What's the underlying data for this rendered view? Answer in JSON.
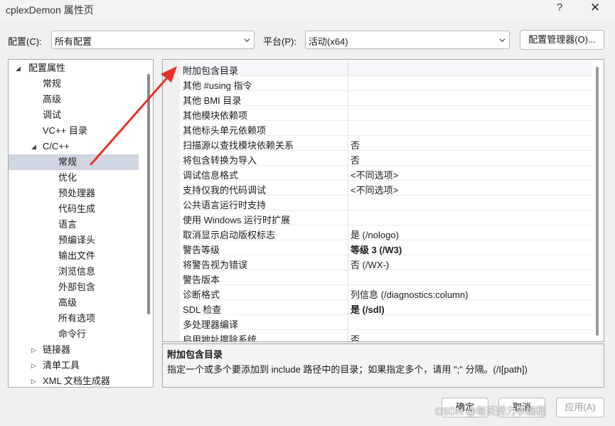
{
  "window": {
    "title": "cplexDemon 属性页",
    "help": "?",
    "close": "✕"
  },
  "toolbar": {
    "config_label": "配置(C):",
    "config_value": "所有配置",
    "platform_label": "平台(P):",
    "platform_value": "活动(x64)",
    "config_manager_button": "配置管理器(O)..."
  },
  "tree": {
    "root": "配置属性",
    "items": [
      "常规",
      "高级",
      "调试",
      "VC++ 目录"
    ],
    "cc": "C/C++",
    "cc_items": [
      "常规",
      "优化",
      "预处理器",
      "代码生成",
      "语言",
      "预编译头",
      "输出文件",
      "浏览信息",
      "外部包含",
      "高级",
      "所有选项",
      "命令行"
    ],
    "collapsed": [
      "链接器",
      "清单工具",
      "XML 文档生成器"
    ],
    "selected": "常规"
  },
  "properties": [
    {
      "name": "附加包含目录",
      "value": ""
    },
    {
      "name": "其他 #using 指令",
      "value": ""
    },
    {
      "name": "其他 BMI 目录",
      "value": ""
    },
    {
      "name": "其他模块依赖项",
      "value": ""
    },
    {
      "name": "其他标头单元依赖项",
      "value": ""
    },
    {
      "name": "扫描源以查找模块依赖关系",
      "value": "否"
    },
    {
      "name": "将包含转换为导入",
      "value": "否"
    },
    {
      "name": "调试信息格式",
      "value": "<不同选项>"
    },
    {
      "name": "支持仅我的代码调试",
      "value": "<不同选项>"
    },
    {
      "name": "公共语言运行时支持",
      "value": ""
    },
    {
      "name": "使用 Windows 运行时扩展",
      "value": ""
    },
    {
      "name": "取消显示启动版权标志",
      "value": "是 (/nologo)"
    },
    {
      "name": "警告等级",
      "value": "等级 3 (/W3)"
    },
    {
      "name": "将警告视为错误",
      "value": "否 (/WX-)"
    },
    {
      "name": "警告版本",
      "value": ""
    },
    {
      "name": "诊断格式",
      "value": "列信息 (/diagnostics:column)"
    },
    {
      "name": "SDL 检查",
      "value": "是 (/sdl)"
    },
    {
      "name": "多处理器编译",
      "value": ""
    },
    {
      "name": "启用地址擦除系统",
      "value": "否"
    }
  ],
  "description": {
    "title": "附加包含目录",
    "text": "指定一个或多个要添加到 include 路径中的目录；如果指定多个，请用 \";\" 分隔。(/I[path])"
  },
  "buttons": {
    "ok": "确定",
    "cancel": "取消",
    "apply": "应用(A)"
  },
  "watermark": "CSDN @每天努力学编程",
  "colors": {
    "selection": "#cfd6e1",
    "annotation_arrow": "#e8332a"
  }
}
